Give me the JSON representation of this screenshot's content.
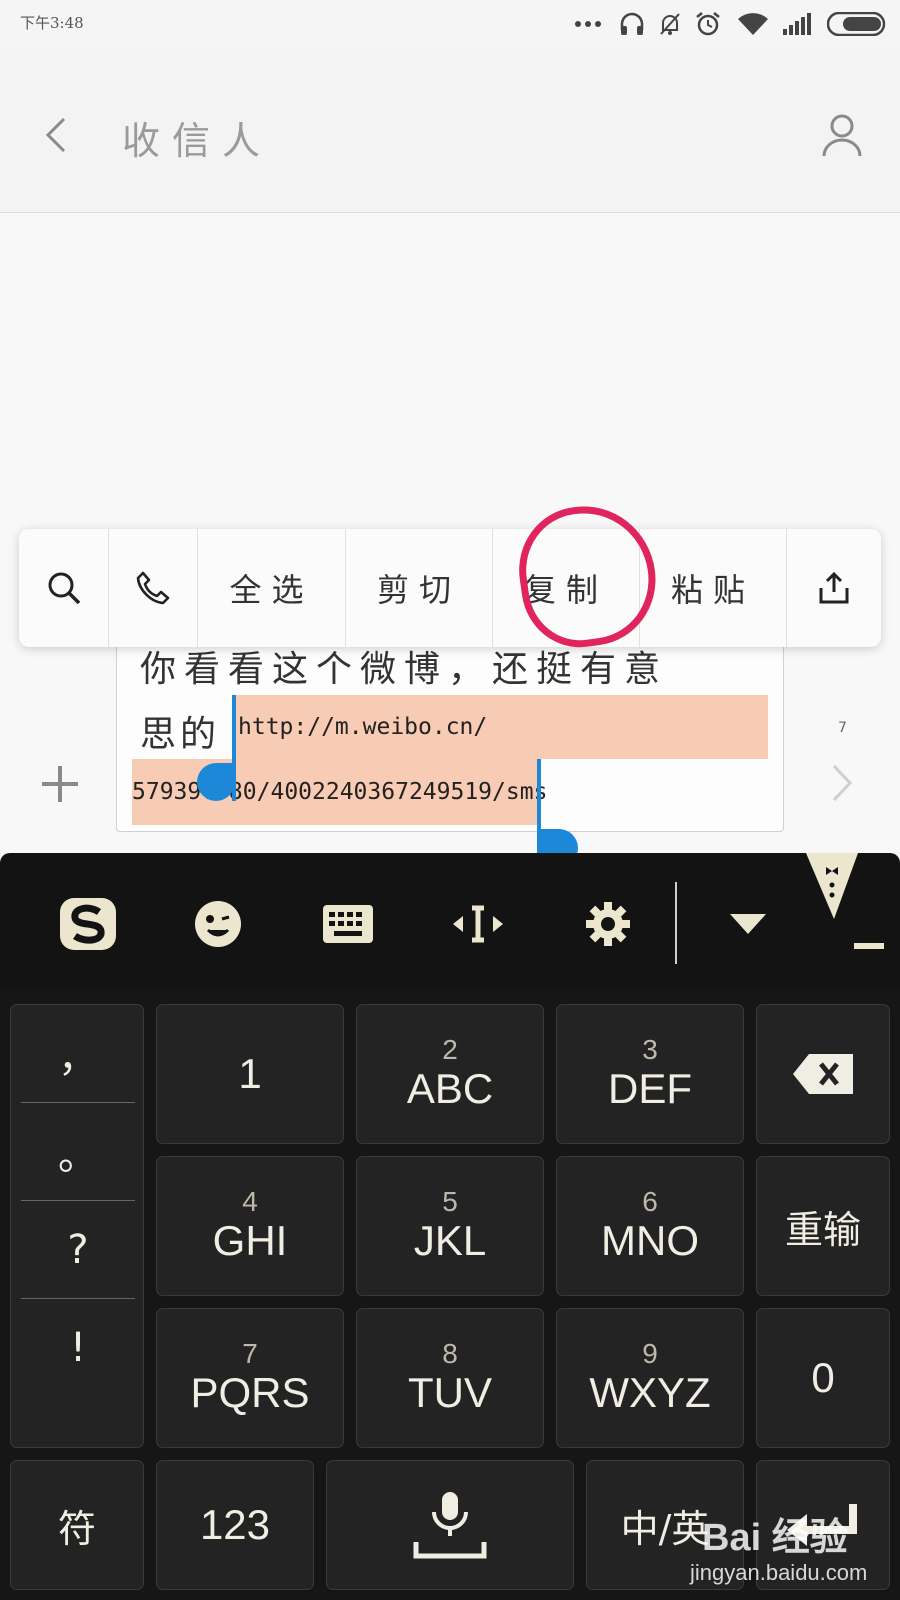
{
  "status_bar": {
    "time": "下午3:48",
    "icons": [
      "more-dots-icon",
      "headphones-icon",
      "bell-off-icon",
      "alarm-icon",
      "wifi-icon",
      "signal-icon",
      "battery-icon"
    ]
  },
  "header": {
    "back_icon": "chevron-left-icon",
    "title": "收信人",
    "contact_icon": "person-icon"
  },
  "context_menu": {
    "items": [
      {
        "icon": "search-icon",
        "label": ""
      },
      {
        "icon": "phone-icon",
        "label": ""
      },
      {
        "label": "全选"
      },
      {
        "label": "剪切"
      },
      {
        "label": "复制"
      },
      {
        "label": "粘贴"
      },
      {
        "icon": "share-icon",
        "label": ""
      }
    ],
    "annotation_number": "6",
    "annotation_color": "#e0245e"
  },
  "compose": {
    "text_line1": "你看看这个微博，还挺有意",
    "text_line2_prefix": "思的",
    "selected_url_line1": "http://m.weibo.cn/",
    "selected_url_line2": "57939?  80/4002240367249519/sms",
    "char_counter": "7",
    "selection_color": "#f8cbb4",
    "handle_color": "#1e88d8"
  },
  "keyboard": {
    "toolbar_icons": [
      "sogou-logo-icon",
      "emoji-icon",
      "keyboard-icon",
      "cursor-move-icon",
      "settings-gear-icon",
      "collapse-down-icon",
      "skin-tuxedo-icon"
    ],
    "punctuation": [
      "，",
      "。",
      "?",
      "!"
    ],
    "keys": [
      {
        "num": "",
        "letters": "1"
      },
      {
        "num": "2",
        "letters": "ABC"
      },
      {
        "num": "3",
        "letters": "DEF"
      },
      {
        "num": "4",
        "letters": "GHI"
      },
      {
        "num": "5",
        "letters": "JKL"
      },
      {
        "num": "6",
        "letters": "MNO"
      },
      {
        "num": "7",
        "letters": "PQRS"
      },
      {
        "num": "8",
        "letters": "TUV"
      },
      {
        "num": "9",
        "letters": "WXYZ"
      }
    ],
    "delete_icon": "backspace-icon",
    "reinput_label": "重输",
    "zero_label": "0",
    "symbols_label": "符",
    "numbers_label": "123",
    "space_icon": "microphone-space-icon",
    "lang_label": "中/英",
    "enter_icon": "enter-icon"
  },
  "watermark": {
    "logo": "Bai 经验",
    "url": "jingyan.baidu.com"
  }
}
